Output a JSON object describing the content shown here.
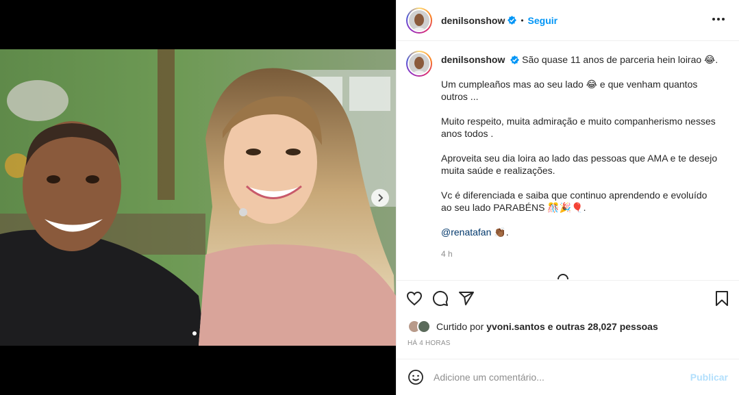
{
  "colors": {
    "accent": "#0095f6",
    "verified": "#0095f6",
    "publish_disabled": "#b2dffc",
    "muted": "#8e8e8e",
    "mention": "#00376b"
  },
  "header": {
    "username": "denilsonshow",
    "separator": "•",
    "follow_label": "Seguir",
    "more_icon": "more-horizontal-icon"
  },
  "caption": {
    "username": "denilsonshow",
    "paragraphs": [
      "São quase 11 anos de parceria hein loirao 😂.",
      "Um cumpleaños mas ao seu lado 😂 e que venham quantos outros ...",
      "Muito respeito, muita admiração e muito companherismo nesses anos todos .",
      "Aproveita seu dia loira ao lado das pessoas que AMA e te desejo muita saúde e realizações.",
      "Vc é diferenciada e saiba que continuo aprendendo e evoluído ao seu lado PARABÉNS 🎊🎉🎈."
    ],
    "mention": "@renatafan",
    "mention_suffix": "👏🏾.",
    "time": "4 h"
  },
  "carousel": {
    "current": 1,
    "total": 2
  },
  "actions": {
    "like": "heart-icon",
    "comment": "comment-icon",
    "share": "share-icon",
    "save": "bookmark-icon"
  },
  "likes": {
    "prefix": "Curtido por",
    "user": "yvoni.santos",
    "middle": "e",
    "others": "outras 28,027 pessoas"
  },
  "posted_ago": "HÁ 4 HORAS",
  "comment_box": {
    "placeholder": "Adicione um comentário...",
    "publish_label": "Publicar"
  }
}
